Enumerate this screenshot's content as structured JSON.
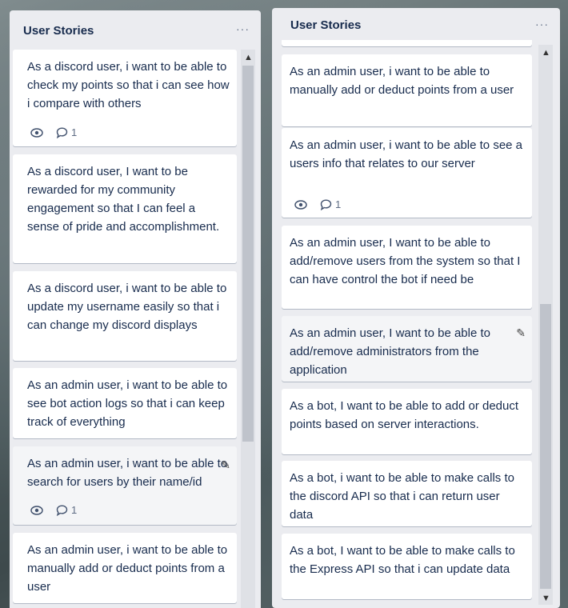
{
  "lists": [
    {
      "title": "User Stories",
      "menu": "···",
      "cards": [
        {
          "text": "As a discord user, i want to be able to check my points so that i can see how i compare with others",
          "watch": "",
          "comments": "1"
        },
        {
          "text": "As a discord user, I want to be rewarded for my community engagement so that I can feel a sense of pride and accomplishment."
        },
        {
          "text": "As a discord user, i want to be able to update my username easily so that i can change my discord displays"
        },
        {
          "text": "As an admin user, i want to be able to see bot action logs so that i can keep track of everything"
        },
        {
          "text": "As an admin user, i want to be able to search for users by their name/id",
          "watch": "",
          "comments": "1"
        },
        {
          "text": "As an admin user, i want to be able to manually add or deduct points from a user"
        }
      ]
    },
    {
      "title": "User Stories",
      "menu": "···",
      "cards": [
        {
          "text": "As an admin user, i want to be able to manually add or deduct points from a user"
        },
        {
          "text": "As an admin user, i want to be able to see a users info that relates to our server",
          "watch": "",
          "comments": "1"
        },
        {
          "text": "As an admin user, I want to be able to add/remove users from the system so that I can have control the bot if need be"
        },
        {
          "text": "As an admin user, I want to be able to add/remove administrators from the application"
        },
        {
          "text": "As a bot, I want to be able to add or deduct points based on server interactions."
        },
        {
          "text": "As a bot, i want to be able to make calls to the discord API so that i can return user data"
        },
        {
          "text": "As a bot, I want to be able to make calls to the Express API so that i can update data"
        }
      ]
    }
  ],
  "icons": {
    "watch": "eye-icon",
    "comment": "comment-icon",
    "edit": "pencil-icon",
    "scroll_up": "chevron-up-icon",
    "scroll_down": "chevron-down-icon"
  },
  "colors": {
    "list_bg": "#ebecf0",
    "card_bg": "#ffffff",
    "text": "#172b4d",
    "muted": "#5e6c84"
  }
}
